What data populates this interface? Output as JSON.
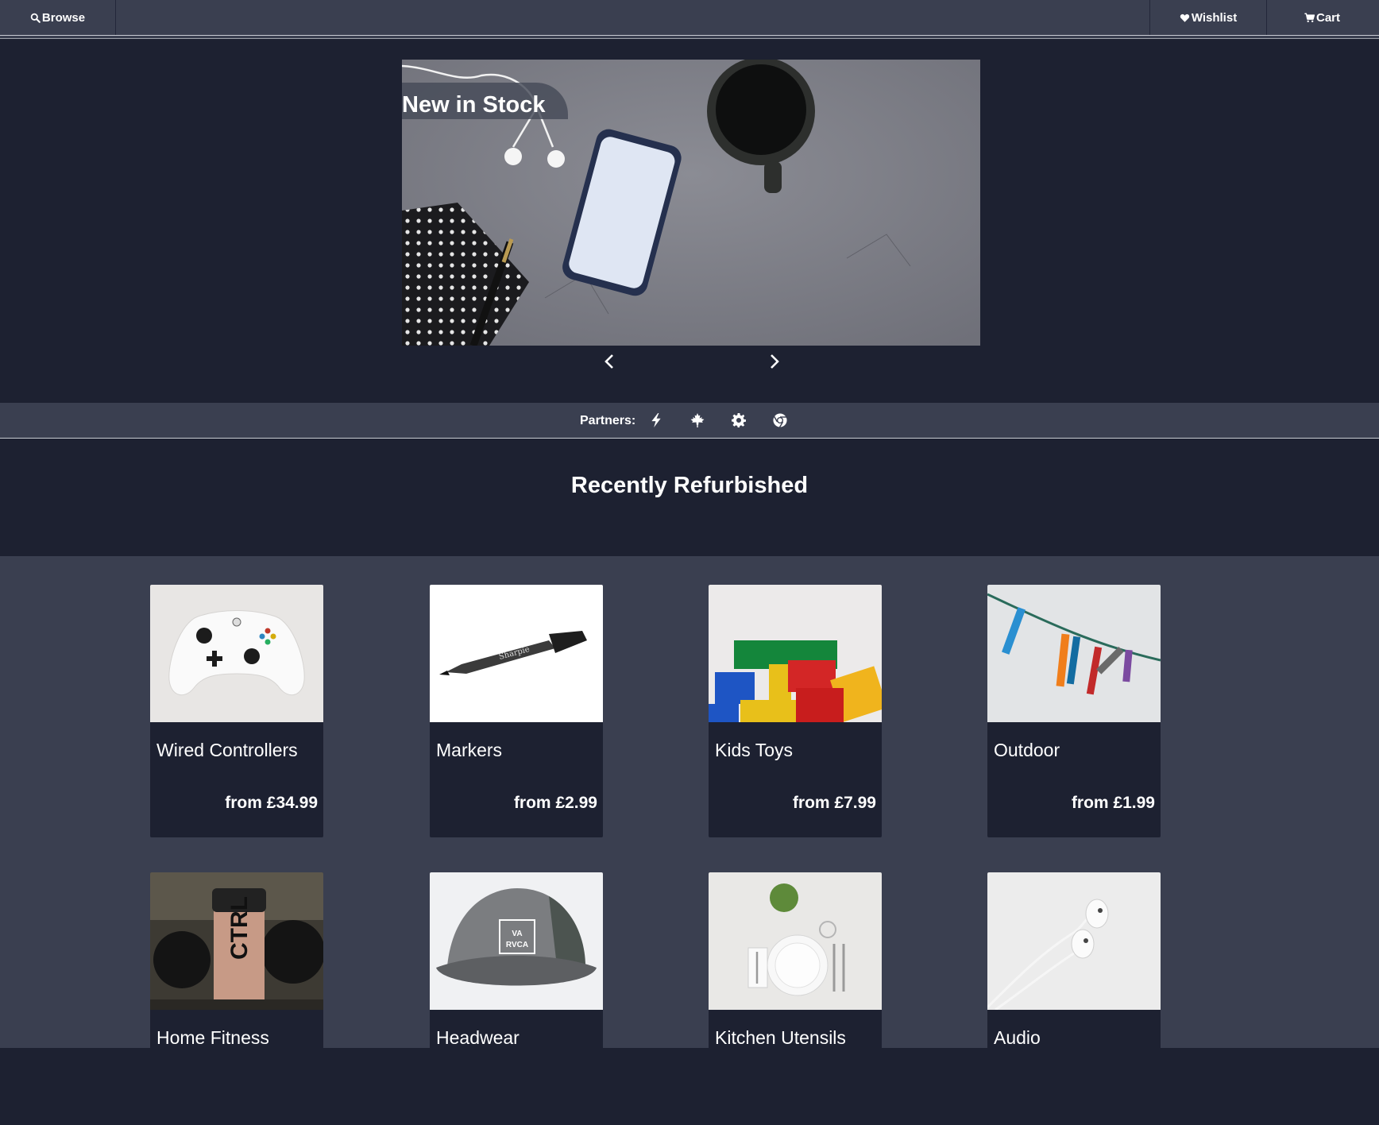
{
  "nav": {
    "browse_label": "Browse",
    "browse_icon": "search-icon",
    "wishlist_label": "Wishlist",
    "wishlist_icon": "heart-icon",
    "cart_label": "Cart",
    "cart_icon": "cart-icon"
  },
  "hero": {
    "label": "New in Stock",
    "prev_icon": "chevron-left-icon",
    "next_icon": "chevron-right-icon"
  },
  "partners": {
    "label": "Partners:",
    "icons": [
      "bolt-icon",
      "maple-leaf-icon",
      "gear-icon",
      "chrome-icon"
    ]
  },
  "section": {
    "title": "Recently Refurbished"
  },
  "products": [
    {
      "name": "Wired Controllers",
      "price": "from £34.99"
    },
    {
      "name": "Markers",
      "price": "from £2.99"
    },
    {
      "name": "Kids Toys",
      "price": "from £7.99"
    },
    {
      "name": "Outdoor",
      "price": "from £1.99"
    },
    {
      "name": "Home Fitness",
      "price": ""
    },
    {
      "name": "Headwear",
      "price": ""
    },
    {
      "name": "Kitchen Utensils",
      "price": ""
    },
    {
      "name": "Audio",
      "price": ""
    }
  ],
  "colors": {
    "page_bg": "#1d2131",
    "bar_bg": "#3a3f50",
    "text": "#ffffff"
  }
}
